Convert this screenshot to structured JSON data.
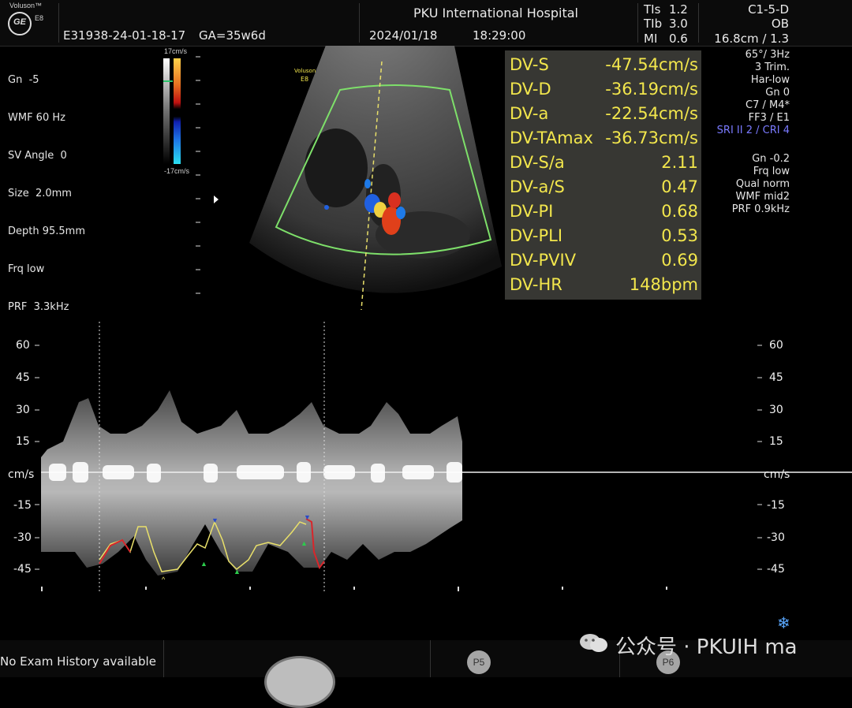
{
  "header": {
    "brand": "Voluson™",
    "model": "E8",
    "logo": "GE",
    "patient_id": "E31938-24-01-18-17",
    "ga": "GA=35w6d",
    "hospital": "PKU International Hospital",
    "date": "2024/01/18",
    "time": "18:29:00",
    "tis_label": "TIs",
    "tis_value": "1.2",
    "tib_label": "TIb",
    "tib_value": "3.0",
    "mi_label": "MI",
    "mi_value": "0.6",
    "probe": "C1-5-D",
    "app": "OB",
    "depth_zoom": "16.8cm / 1.3"
  },
  "left_params": [
    "Gn  -5",
    "WMF 60 Hz",
    "SV Angle  0",
    "Size  2.0mm",
    "Depth 95.5mm",
    "Frq low",
    "PRF  3.3kHz"
  ],
  "colorbar": {
    "top": "17cm/s",
    "bottom": "-17cm/s"
  },
  "image_label": {
    "line1": "Voluson",
    "line2": "E8"
  },
  "right_params_1": [
    "65°/  3Hz",
    "3 Trim.",
    "Har-low",
    "Gn   0",
    "C7 / M4*",
    "FF3 / E1"
  ],
  "right_params_sri": "SRI II 2 / CRI 4",
  "right_params_2": [
    "Gn -0.2",
    "Frq low",
    "Qual norm",
    "WMF mid2",
    "PRF  0.9kHz"
  ],
  "measurements": [
    {
      "k": "DV-S",
      "v": "-47.54cm/s"
    },
    {
      "k": "DV-D",
      "v": "-36.19cm/s"
    },
    {
      "k": "DV-a",
      "v": "-22.54cm/s"
    },
    {
      "k": "DV-TAmax",
      "v": "-36.73cm/s"
    },
    {
      "k": "DV-S/a",
      "v": "2.11"
    },
    {
      "k": "DV-a/S",
      "v": "0.47"
    },
    {
      "k": "DV-PI",
      "v": "0.68"
    },
    {
      "k": "DV-PLI",
      "v": "0.53"
    },
    {
      "k": "DV-PVIV",
      "v": "0.69"
    },
    {
      "k": "DV-HR",
      "v": "148bpm"
    }
  ],
  "doppler": {
    "ticks": [
      "60",
      "45",
      "30",
      "15",
      "cm/s",
      "-15",
      "-30",
      "-45"
    ],
    "unit": "cm/s"
  },
  "bottom": {
    "history": "No Exam History available",
    "p5": "P5",
    "p6": "P6",
    "watermark": "公众号 · PKUIH ma"
  },
  "colors": {
    "measure_text": "#f2e64c",
    "sri_text": "#7a7aff",
    "roi_box": "#7ee06a",
    "trace_yellow": "#e9e06a",
    "trace_red": "#d8262b"
  },
  "icons": [
    "ge-logo-icon",
    "freeze-snowflake-icon",
    "wechat-icon",
    "trackball-icon"
  ]
}
